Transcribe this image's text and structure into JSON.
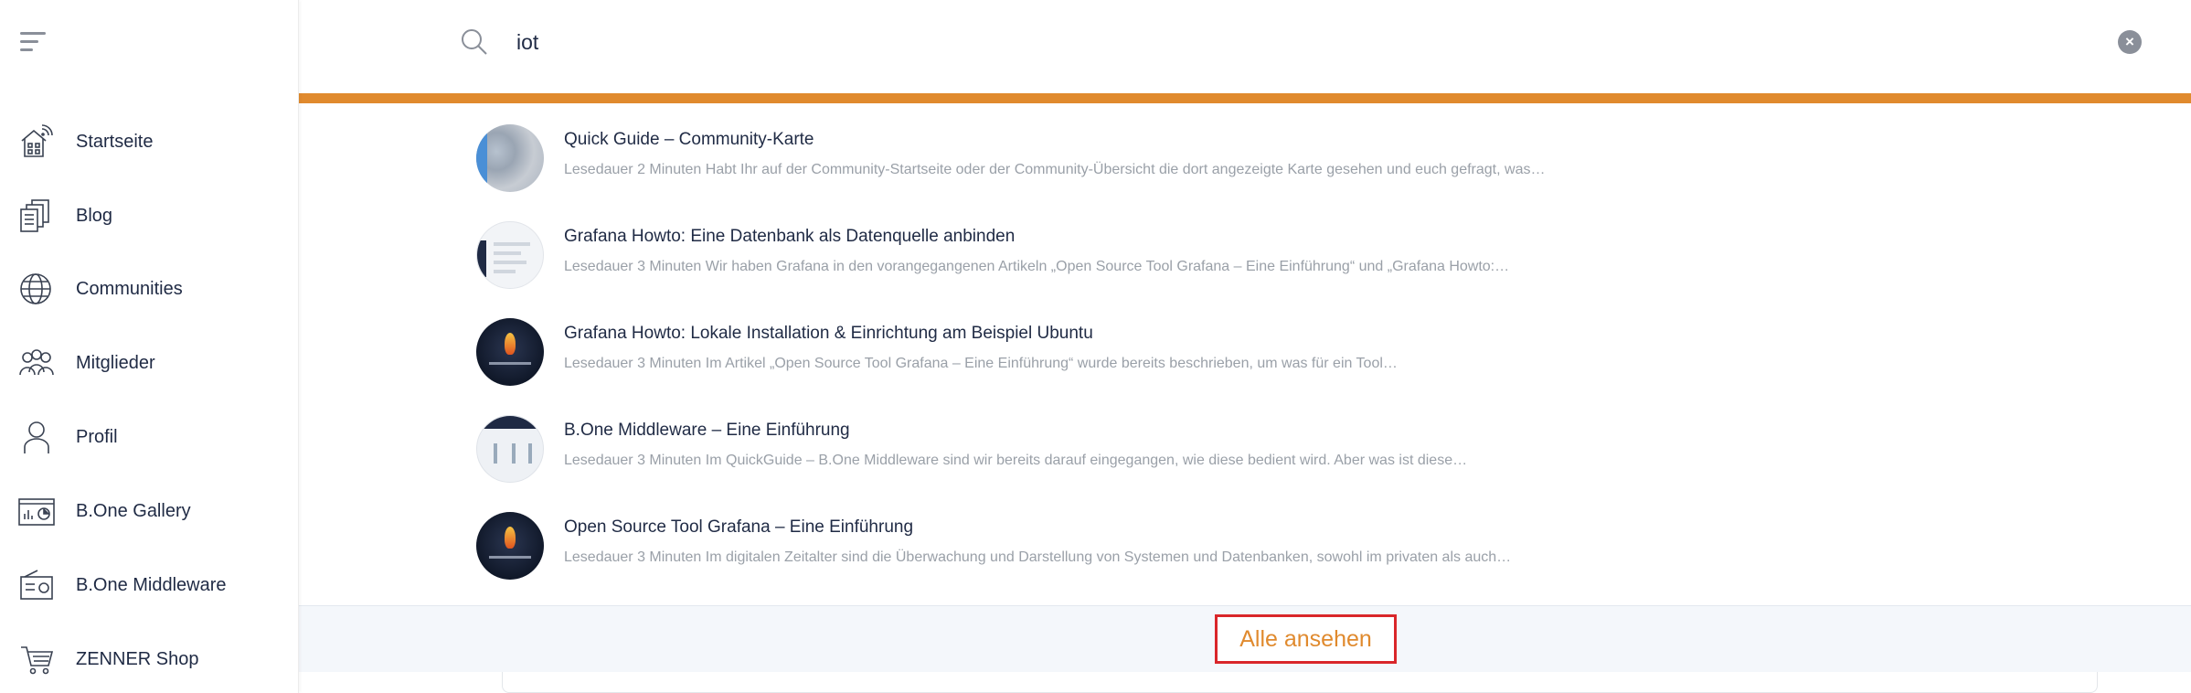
{
  "search": {
    "query": "iot"
  },
  "sidebar": {
    "items": [
      {
        "label": "Startseite",
        "icon": "home-wifi-icon"
      },
      {
        "label": "Blog",
        "icon": "documents-icon"
      },
      {
        "label": "Communities",
        "icon": "globe-icon"
      },
      {
        "label": "Mitglieder",
        "icon": "members-icon"
      },
      {
        "label": "Profil",
        "icon": "user-icon"
      },
      {
        "label": "B.One Gallery",
        "icon": "gallery-icon"
      },
      {
        "label": "B.One Middleware",
        "icon": "radio-device-icon"
      },
      {
        "label": "ZENNER Shop",
        "icon": "cart-icon"
      }
    ]
  },
  "results": [
    {
      "title": "Quick Guide – Community-Karte",
      "desc": "Lesedauer 2 Minuten Habt Ihr auf der Community-Startseite oder der Community-Übersicht die dort angezeigte Karte gesehen und euch gefragt, was…"
    },
    {
      "title": "Grafana Howto: Eine Datenbank als Datenquelle anbinden",
      "desc": "Lesedauer 3 Minuten Wir haben Grafana in den vorangegangenen Artikeln „Open Source Tool Grafana – Eine Einführung“ und „Grafana Howto:…"
    },
    {
      "title": "Grafana Howto: Lokale Installation & Einrichtung am Beispiel Ubuntu",
      "desc": "Lesedauer 3 Minuten Im Artikel „Open Source Tool Grafana – Eine Einführung“ wurde bereits beschrieben, um was für ein Tool…"
    },
    {
      "title": "B.One Middleware – Eine Einführung",
      "desc": "Lesedauer 3 Minuten Im QuickGuide – B.One Middleware sind wir bereits darauf eingegangen, wie diese bedient wird. Aber was ist diese…"
    },
    {
      "title": "Open Source Tool Grafana – Eine Einführung",
      "desc": "Lesedauer 3 Minuten Im digitalen Zeitalter sind die Überwachung und Darstellung von Systemen und Datenbanken, sowohl im privaten als auch…"
    }
  ],
  "footer": {
    "view_all_label": "Alle ansehen"
  },
  "colors": {
    "accent": "#e08a2e",
    "highlight_border": "#d9262a",
    "text": "#1f2a44",
    "muted": "#9aa0a8"
  }
}
